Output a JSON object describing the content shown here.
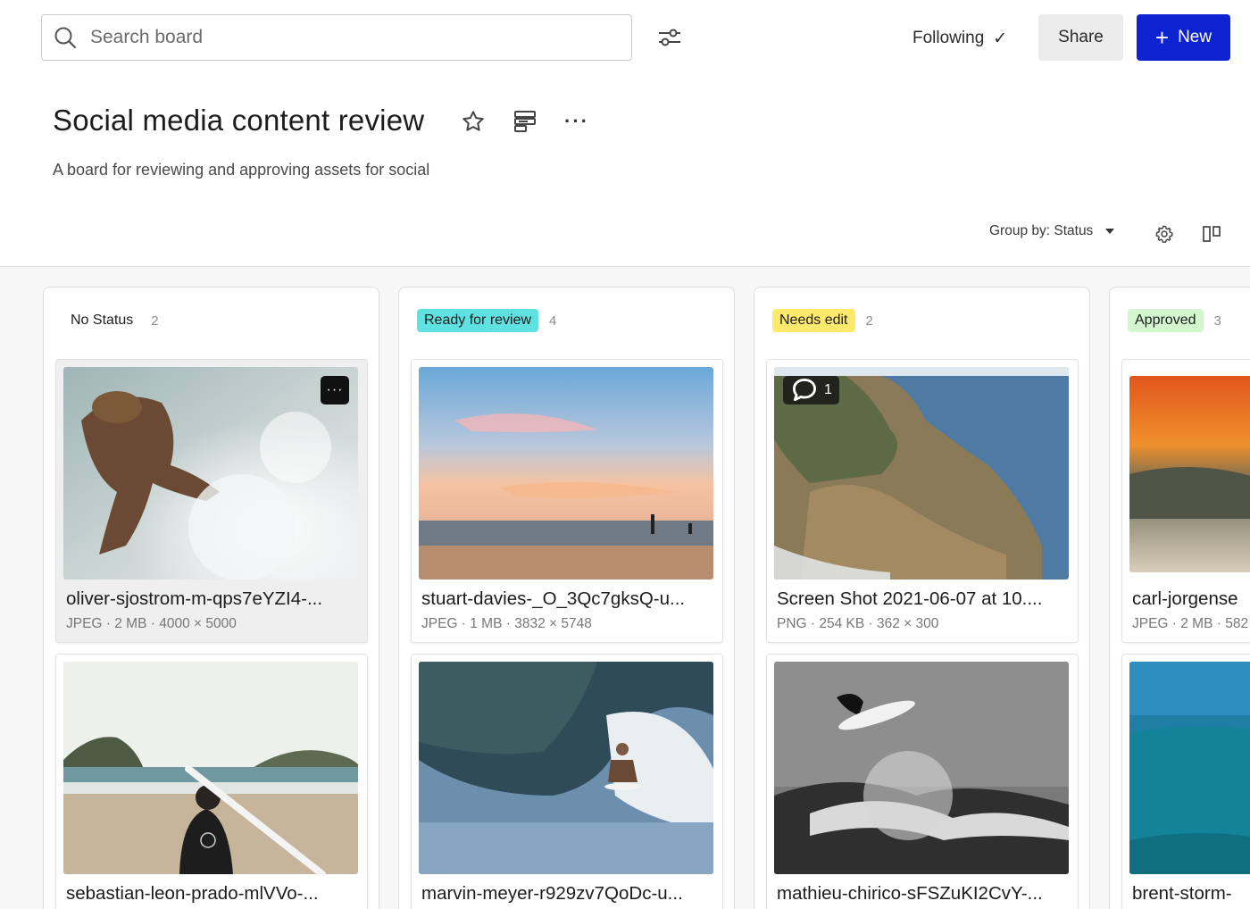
{
  "topbar": {
    "search_placeholder": "Search board",
    "following_label": "Following",
    "following_check": "✓",
    "share_label": "Share",
    "new_label": "New",
    "new_icon": "+"
  },
  "header": {
    "title": "Social media content review",
    "description": "A board for reviewing and approving assets for social",
    "more_icon": "···"
  },
  "toolbar": {
    "group_by_label": "Group by: Status"
  },
  "columns": [
    {
      "label": "No Status",
      "count": "2",
      "color": "transparent",
      "cards": [
        {
          "name": "oliver-sjostrom-m-qps7eYZI4-...",
          "meta": "JPEG · 2 MB · 4000 × 5000",
          "badge": "···"
        },
        {
          "name": "sebastian-leon-prado-mlVVo-...",
          "meta": ""
        }
      ]
    },
    {
      "label": "Ready for review",
      "count": "4",
      "color": "#5fe1e1",
      "cards": [
        {
          "name": "stuart-davies-_O_3Qc7gksQ-u...",
          "meta": "JPEG · 1 MB · 3832 × 5748"
        },
        {
          "name": "marvin-meyer-r929zv7QoDc-u...",
          "meta": ""
        }
      ]
    },
    {
      "label": "Needs edit",
      "count": "2",
      "color": "#fde96b",
      "cards": [
        {
          "name": "Screen Shot 2021-06-07 at 10....",
          "meta": "PNG · 254 KB · 362 × 300",
          "comments": "1"
        },
        {
          "name": "mathieu-chirico-sFSZuKI2CvY-...",
          "meta": ""
        }
      ]
    },
    {
      "label": "Approved",
      "count": "3",
      "color": "#d3f6cf",
      "cards": [
        {
          "name": "carl-jorgense",
          "meta": "JPEG · 2 MB · 582"
        },
        {
          "name": "brent-storm-",
          "meta": ""
        }
      ]
    }
  ]
}
